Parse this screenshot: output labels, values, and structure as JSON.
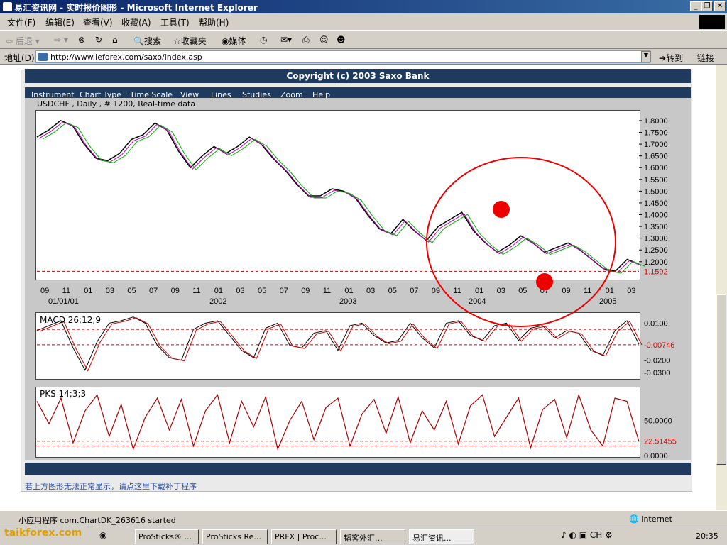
{
  "window": {
    "title": "易汇资讯网 - 实时报价图形 - Microsoft Internet Explorer"
  },
  "menu": [
    "文件(F)",
    "编辑(E)",
    "查看(V)",
    "收藏(A)",
    "工具(T)",
    "帮助(H)"
  ],
  "toolbar": {
    "back": "后退",
    "search": "搜索",
    "favorites": "收藏夹",
    "media": "媒体"
  },
  "address": {
    "label": "地址(D)",
    "url": "http://www.ieforex.com/saxo/index.asp",
    "go": "转到",
    "links": "链接"
  },
  "page": {
    "copyright": "Copyright (c) 2003 Saxo Bank",
    "chart_menu": [
      "Instrument",
      "Chart Type",
      "Time Scale",
      "View",
      "Lines",
      "Studies",
      "Zoom",
      "Help"
    ],
    "chart_header": "USDCHF , Daily , # 1200, Real-time data",
    "notice": "若上方图形无法正常显示，请点这里下载补丁程序"
  },
  "chart_data": [
    {
      "type": "line",
      "name": "USDCHF",
      "ylabels": [
        "1.8000",
        "1.7500",
        "1.7000",
        "1.6500",
        "1.6000",
        "1.5500",
        "1.5000",
        "1.4500",
        "1.4000",
        "1.3500",
        "1.3000",
        "1.2500",
        "1.2000"
      ],
      "last": "1.1592",
      "months": [
        "09",
        "11",
        "01",
        "03",
        "05",
        "07",
        "09",
        "11",
        "01",
        "03",
        "05",
        "07",
        "09",
        "11",
        "01",
        "03",
        "05",
        "07",
        "09",
        "11",
        "01",
        "03",
        "05",
        "07",
        "09",
        "11",
        "01",
        "03"
      ],
      "years": [
        "01/01/01",
        "2002",
        "2003",
        "2004",
        "2005"
      ],
      "series": [
        1.73,
        1.76,
        1.8,
        1.78,
        1.7,
        1.64,
        1.63,
        1.66,
        1.72,
        1.74,
        1.79,
        1.76,
        1.67,
        1.6,
        1.65,
        1.69,
        1.66,
        1.69,
        1.73,
        1.7,
        1.64,
        1.59,
        1.53,
        1.48,
        1.48,
        1.51,
        1.5,
        1.47,
        1.4,
        1.34,
        1.32,
        1.38,
        1.33,
        1.29,
        1.35,
        1.38,
        1.41,
        1.33,
        1.28,
        1.24,
        1.27,
        1.31,
        1.28,
        1.24,
        1.26,
        1.28,
        1.25,
        1.21,
        1.17,
        1.16,
        1.21,
        1.19
      ]
    },
    {
      "type": "line",
      "name": "MACD 26;12;9",
      "ylabels": [
        "0.0100",
        "-0.0200",
        "-0.0300"
      ],
      "last": "-0.00746",
      "series": [
        0.004,
        0.008,
        0.012,
        -0.01,
        -0.028,
        -0.005,
        0.01,
        0.012,
        0.015,
        0.01,
        -0.008,
        -0.018,
        -0.02,
        0.005,
        0.01,
        0.012,
        0.0,
        -0.012,
        -0.018,
        0.006,
        0.01,
        -0.008,
        -0.01,
        0.002,
        0.004,
        -0.012,
        0.008,
        0.01,
        0.0,
        -0.006,
        -0.004,
        0.01,
        -0.002,
        -0.01,
        0.01,
        0.012,
        0.0,
        -0.004,
        0.008,
        0.01,
        -0.004,
        0.006,
        0.008,
        -0.002,
        0.004,
        0.002,
        -0.012,
        -0.016,
        0.004,
        0.012,
        -0.007
      ]
    },
    {
      "type": "line",
      "name": "PKS 14;3;3",
      "ylabels": [
        "50.0000",
        "0.0000"
      ],
      "last": "22.51455",
      "series": [
        85,
        50,
        90,
        20,
        70,
        95,
        30,
        80,
        10,
        60,
        90,
        40,
        88,
        15,
        70,
        95,
        20,
        85,
        45,
        92,
        10,
        55,
        85,
        25,
        75,
        90,
        15,
        65,
        88,
        35,
        92,
        20,
        70,
        40,
        85,
        18,
        78,
        95,
        30,
        60,
        90,
        12,
        72,
        88,
        28,
        95,
        40,
        15,
        90,
        85,
        22
      ]
    }
  ],
  "status": {
    "left": "小应用程序 com.ChartDK_263616 started",
    "zone": "Internet"
  },
  "taskbar": {
    "items": [
      "ProSticks® ...",
      "ProSticks Re...",
      "PRFX | Proc...",
      "韬客外汇...",
      "易汇资讯..."
    ],
    "clock": "20:35"
  },
  "watermark": "taikforex.com"
}
